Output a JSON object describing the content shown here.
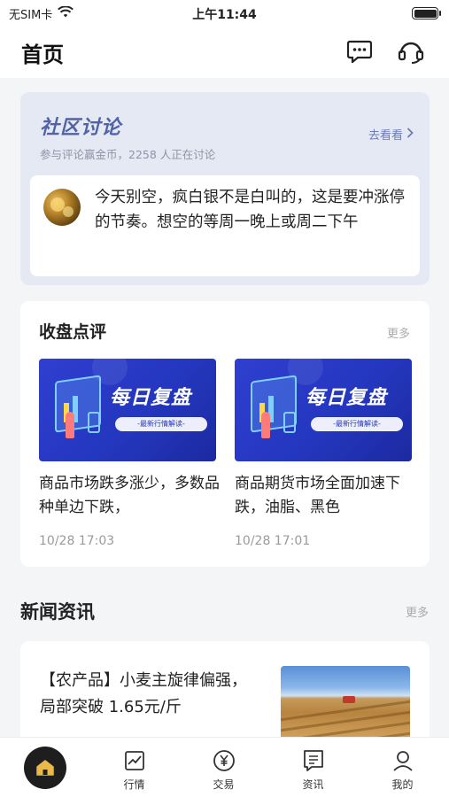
{
  "status_bar": {
    "carrier": "无SIM卡",
    "time": "上午11:44"
  },
  "header": {
    "title": "首页",
    "message_icon": "message-dots-icon",
    "service_icon": "headset-service-icon"
  },
  "community": {
    "title": "社区讨论",
    "subtitle": "参与评论赢金币，2258 人正在讨论",
    "more": "去看看",
    "post": {
      "text": "今天别空，疯白银不是白叫的，这是要冲涨停的节奏。想空的等周一晚上或周二下午"
    }
  },
  "review": {
    "title": "收盘点评",
    "more": "更多",
    "cards": [
      {
        "banner_title": "每日复盘",
        "banner_sub": "-最新行情解读-",
        "text": "商品市场跌多涨少，多数品种单边下跌，",
        "date": "10/28 17:03"
      },
      {
        "banner_title": "每日复盘",
        "banner_sub": "-最新行情解读-",
        "text": "商品期货市场全面加速下跌，油脂、黑色",
        "date": "10/28 17:01"
      }
    ]
  },
  "news": {
    "title": "新闻资讯",
    "more": "更多",
    "items": [
      {
        "text": "【农产品】小麦主旋律偏强，局部突破 1.65元/斤"
      }
    ]
  },
  "tabbar": {
    "items": [
      {
        "label": "",
        "icon": "home-icon"
      },
      {
        "label": "行情",
        "icon": "chart-icon"
      },
      {
        "label": "交易",
        "icon": "yen-icon"
      },
      {
        "label": "资讯",
        "icon": "news-icon"
      },
      {
        "label": "我的",
        "icon": "user-icon"
      }
    ]
  },
  "colors": {
    "accent": "#5163a6",
    "community_bg": "#e5e9f4",
    "banner_blue": "#2437bf",
    "tab_home": "#1e1e1e"
  }
}
